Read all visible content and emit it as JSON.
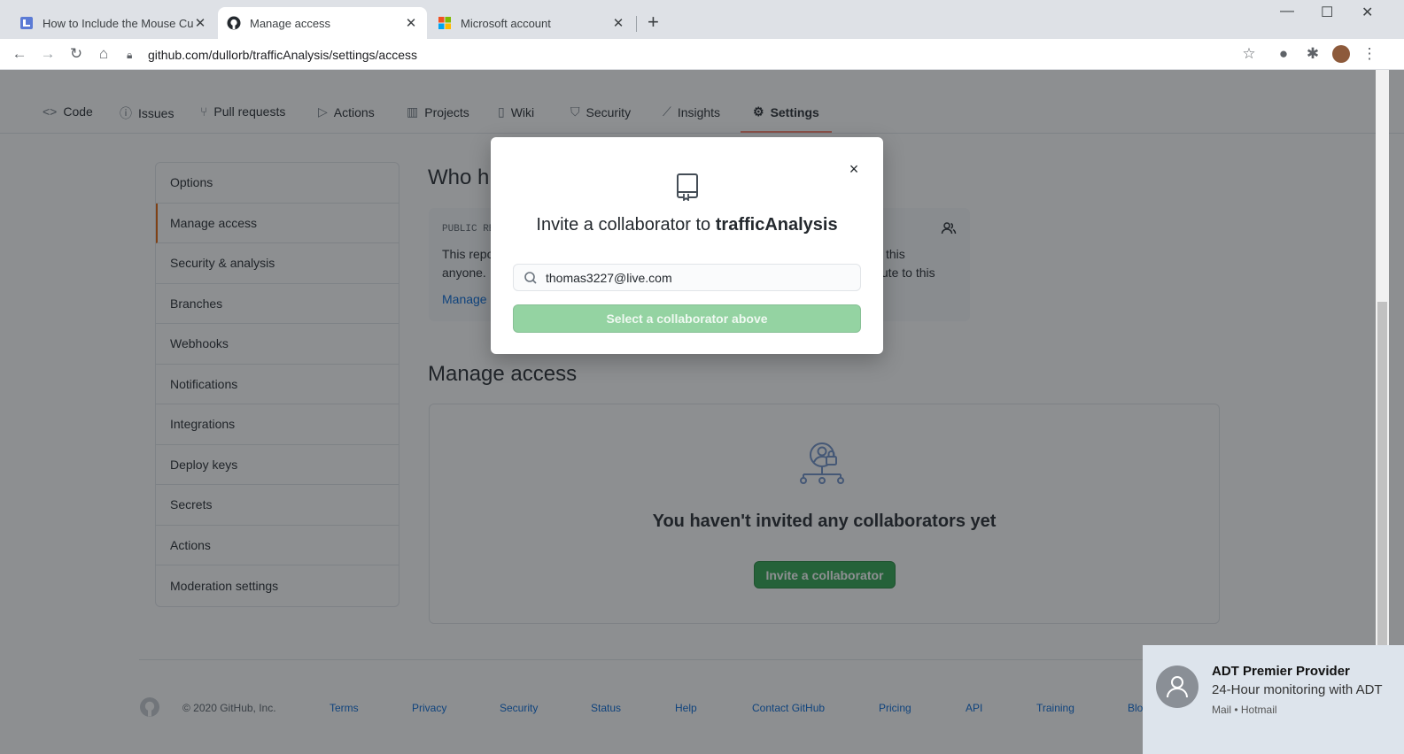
{
  "browser": {
    "tabs": [
      {
        "title": "How to Include the Mouse Curso",
        "active": false
      },
      {
        "title": "Manage access",
        "active": true
      },
      {
        "title": "Microsoft account",
        "active": false
      }
    ],
    "url": "github.com/dullorb/trafficAnalysis/settings/access"
  },
  "repo_nav": {
    "items": [
      {
        "label": "Code",
        "icon": "code-icon"
      },
      {
        "label": "Issues",
        "icon": "issue-icon"
      },
      {
        "label": "Pull requests",
        "icon": "pull-request-icon"
      },
      {
        "label": "Actions",
        "icon": "play-icon"
      },
      {
        "label": "Projects",
        "icon": "project-icon"
      },
      {
        "label": "Wiki",
        "icon": "book-icon"
      },
      {
        "label": "Security",
        "icon": "shield-icon"
      },
      {
        "label": "Insights",
        "icon": "graph-icon"
      },
      {
        "label": "Settings",
        "icon": "gear-icon"
      }
    ],
    "selected": "Settings"
  },
  "sidebar": {
    "items": [
      {
        "label": "Options"
      },
      {
        "label": "Manage access"
      },
      {
        "label": "Security & analysis"
      },
      {
        "label": "Branches"
      },
      {
        "label": "Webhooks"
      },
      {
        "label": "Notifications"
      },
      {
        "label": "Integrations"
      },
      {
        "label": "Deploy keys"
      },
      {
        "label": "Secrets"
      },
      {
        "label": "Actions"
      },
      {
        "label": "Moderation settings"
      }
    ],
    "selected": "Manage access"
  },
  "who_section": {
    "title_visible": "Who h",
    "label_visible": "PUBLIC RE",
    "text_left_1": "This repo",
    "text_left_2": "anyone.",
    "text_right_1": "this",
    "text_right_2": "ibute to this",
    "link_visible": "Manage"
  },
  "manage_access": {
    "title": "Manage access",
    "empty_message": "You haven't invited any collaborators yet",
    "invite_button": "Invite a collaborator"
  },
  "modal": {
    "title_prefix": "Invite a collaborator to",
    "repo_name": "trafficAnalysis",
    "search_value": "thomas3227@live.com",
    "submit_label": "Select a collaborator above",
    "close_label": "×"
  },
  "footer": {
    "copyright": "© 2020 GitHub, Inc.",
    "links": [
      "Terms",
      "Privacy",
      "Security",
      "Status",
      "Help",
      "Contact GitHub",
      "Pricing",
      "API",
      "Training",
      "Blo"
    ]
  },
  "notification": {
    "title": "ADT Premier Provider",
    "body": "24-Hour monitoring with ADT",
    "source": "Mail • Hotmail"
  },
  "colors": {
    "accent_orange": "#f9826c",
    "primary_green": "#2ea44f",
    "disabled_green": "#94d3a2",
    "link_blue": "#0366d6"
  }
}
